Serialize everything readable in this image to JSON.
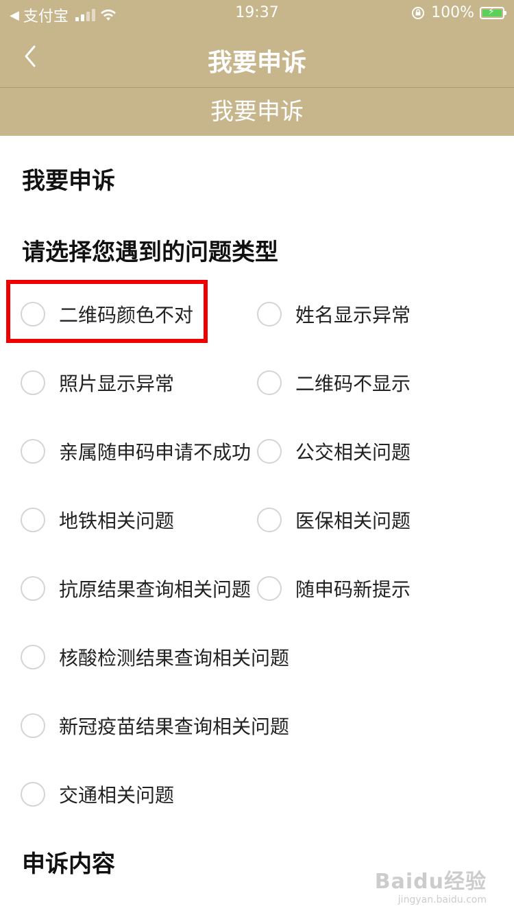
{
  "status_bar": {
    "carrier": "支付宝",
    "time": "19:37",
    "battery_percent": "100%"
  },
  "nav": {
    "title": "我要申诉"
  },
  "sub_header": {
    "title": "我要申诉"
  },
  "page": {
    "title": "我要申诉",
    "question_title": "请选择您遇到的问题类型",
    "content_title": "申诉内容"
  },
  "options": [
    {
      "left": "二维码颜色不对",
      "right": "姓名显示异常"
    },
    {
      "left": "照片显示异常",
      "right": "二维码不显示"
    },
    {
      "left": "亲属随申码申请不成功",
      "right": "公交相关问题"
    },
    {
      "left": "地铁相关问题",
      "right": "医保相关问题"
    },
    {
      "left": "抗原结果查询相关问题",
      "right": "随申码新提示"
    },
    {
      "left": "核酸检测结果查询相关问题",
      "right": null
    },
    {
      "left": "新冠疫苗结果查询相关问题",
      "right": null
    },
    {
      "left": "交通相关问题",
      "right": null
    }
  ],
  "watermark": {
    "main": "Baidu经验",
    "sub": "jingyan.baidu.com"
  },
  "colors": {
    "header_bg": "#c7b58b",
    "highlight": "#ee0000",
    "radio_border": "#d4d4d4"
  }
}
